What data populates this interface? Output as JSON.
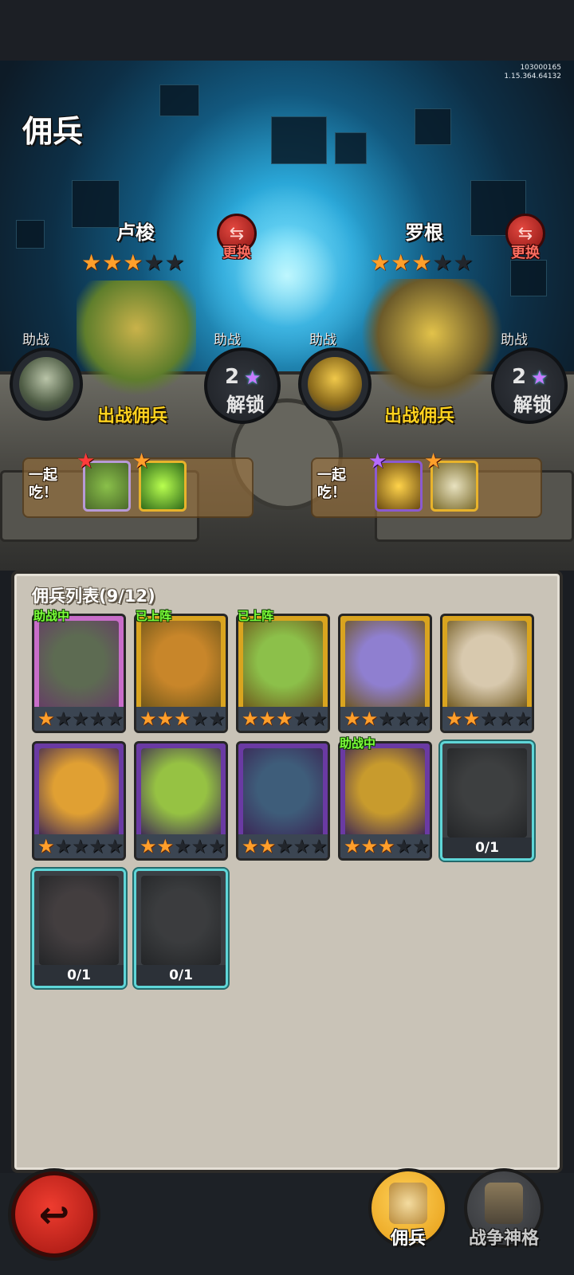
{
  "version": {
    "line1": "103000165",
    "line2": "1.15.364.64132"
  },
  "title": "佣兵",
  "slots": [
    {
      "name": "卢梭",
      "stars": 3,
      "max_stars": 5,
      "swap_label": "更换",
      "deploy_label": "出战佣兵",
      "assist_label": "助战",
      "unlock_label": "解锁",
      "unlock_cost": "2",
      "eat_label_1": "一起",
      "eat_label_2": "吃！"
    },
    {
      "name": "罗根",
      "stars": 3,
      "max_stars": 5,
      "swap_label": "更换",
      "deploy_label": "出战佣兵",
      "assist_label": "助战",
      "unlock_label": "解锁",
      "unlock_cost": "2",
      "eat_label_1": "一起",
      "eat_label_2": "吃！"
    }
  ],
  "list": {
    "title": "佣兵列表(9/12)",
    "tags": {
      "assisting": "助战中",
      "deployed": "已上阵"
    },
    "cards": [
      {
        "frame": "pink",
        "tag": "助战中",
        "stars": 1,
        "color": "#5d6b52"
      },
      {
        "frame": "gold",
        "tag": "已上阵",
        "stars": 3,
        "color": "#c8862a"
      },
      {
        "frame": "gold",
        "tag": "已上阵",
        "stars": 3,
        "color": "#8cc04a"
      },
      {
        "frame": "gold",
        "tag": "",
        "stars": 2,
        "color": "#8f7fd0"
      },
      {
        "frame": "gold",
        "tag": "",
        "stars": 2,
        "color": "#d8c9ae"
      },
      {
        "frame": "purple",
        "tag": "",
        "stars": 1,
        "color": "#e0a033"
      },
      {
        "frame": "purple",
        "tag": "",
        "stars": 2,
        "color": "#96c243"
      },
      {
        "frame": "purple",
        "tag": "",
        "stars": 2,
        "color": "#3e5d7a"
      },
      {
        "frame": "purple",
        "tag": "助战中",
        "stars": 3,
        "color": "#c89b2d"
      },
      {
        "frame": "locked",
        "progress": "0/1",
        "color": "#4a4f52"
      },
      {
        "frame": "locked",
        "progress": "0/1",
        "color": "#5a4b50"
      },
      {
        "frame": "locked",
        "progress": "0/1",
        "color": "#474c52"
      }
    ]
  },
  "nav": {
    "back_icon": "back-arrow-icon",
    "mercenary": "佣兵",
    "war_relics": "战争神格"
  },
  "colors": {
    "star_active": "#ff9f2b",
    "deploy_text": "#ffd21f",
    "tag_text": "#7dff3b",
    "swap_red": "#e2473f"
  }
}
